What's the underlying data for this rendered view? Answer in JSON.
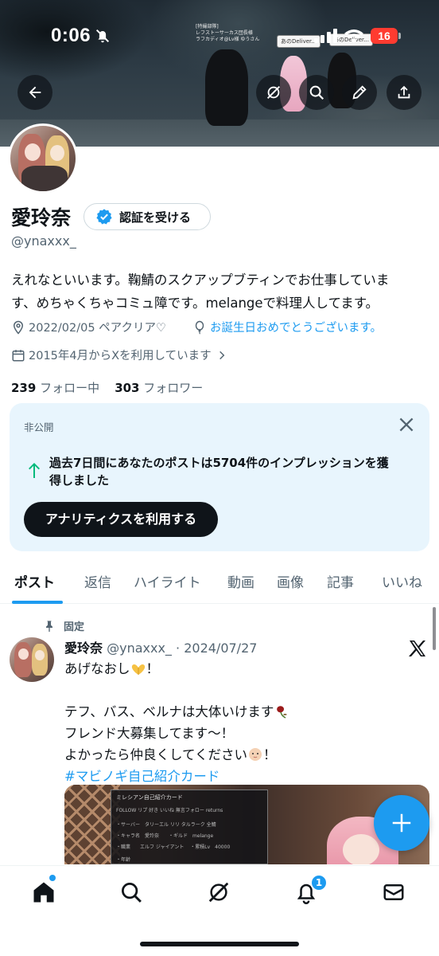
{
  "status_bar": {
    "time": "0:06",
    "battery": "16",
    "battery_color": "#ff3b30"
  },
  "banner": {
    "bubble_1": "あのDeliver...",
    "bubble_2": "あのDeliver...",
    "nametag_line1": "[特撮部隊]",
    "nametag_line2": "レフストーサーカス団長様",
    "nametag_line3": "ラフカディオ@Lv様 ゆうさん"
  },
  "header_icons": {
    "back": "back-arrow-icon",
    "grok": "grok-icon",
    "search": "search-icon",
    "edit": "pencil-icon",
    "share": "share-icon"
  },
  "profile": {
    "display_name": "愛玲奈",
    "verify_label": "認証を受ける",
    "handle": "@ynaxxx_",
    "bio_line1": "えれなといいます。鞠鯖のスクアップブティンでお仕事していま",
    "bio_line2": "す、めちゃくちゃコミュ障です。melangeで料理人してます。",
    "location": "2022/02/05 ペアクリア♡",
    "birthday": "お誕生日おめでとうございます。",
    "joined": "2015年4月からXを利用しています",
    "following_count": "239",
    "following_label": "フォロー中",
    "followers_count": "303",
    "followers_label": "フォロワー"
  },
  "analytics_card": {
    "label": "非公開",
    "text_line1": "過去7日間にあなたのポストは5704件のインプレッションを獲",
    "text_line2": "得しました",
    "button": "アナリティクスを利用する",
    "arrow_color": "#00ba7c"
  },
  "tabs": [
    {
      "label": "ポスト",
      "active": true
    },
    {
      "label": "返信"
    },
    {
      "label": "ハイライト"
    },
    {
      "label": "動画"
    },
    {
      "label": "画像"
    },
    {
      "label": "記事"
    },
    {
      "label": "いいね"
    }
  ],
  "tweet": {
    "pinned_label": "固定",
    "author_name": "愛玲奈",
    "author_handle": "@ynaxxx_",
    "separator": " · ",
    "date": "2024/07/27",
    "line1": "あげなおし",
    "line1_end": "！",
    "line2": "",
    "line3": "テフ、バス、ベルナは大体いけます",
    "line4": "フレンド大募集してます〜！",
    "line5": "よかったら仲良くしてください",
    "line5_end": "！",
    "hashtag": "#マビノギ自己紹介カード",
    "image": {
      "title": "ミレシアン自己紹介カード",
      "row1": "FOLLOW  リプ 好き いいね 無言フォロー returns",
      "row2": "・サーバー　タリーエル リリ タルラーク 全鯖",
      "row3": "・キャラ名　愛玲奈　　・ギルド　melange",
      "row4": "・職業　　エルフ ジャイアント 　・累積Lv　40000",
      "row5": "・年齢"
    }
  },
  "bottom_nav": {
    "notification_count": "1",
    "accent": "#1d9bf0"
  }
}
